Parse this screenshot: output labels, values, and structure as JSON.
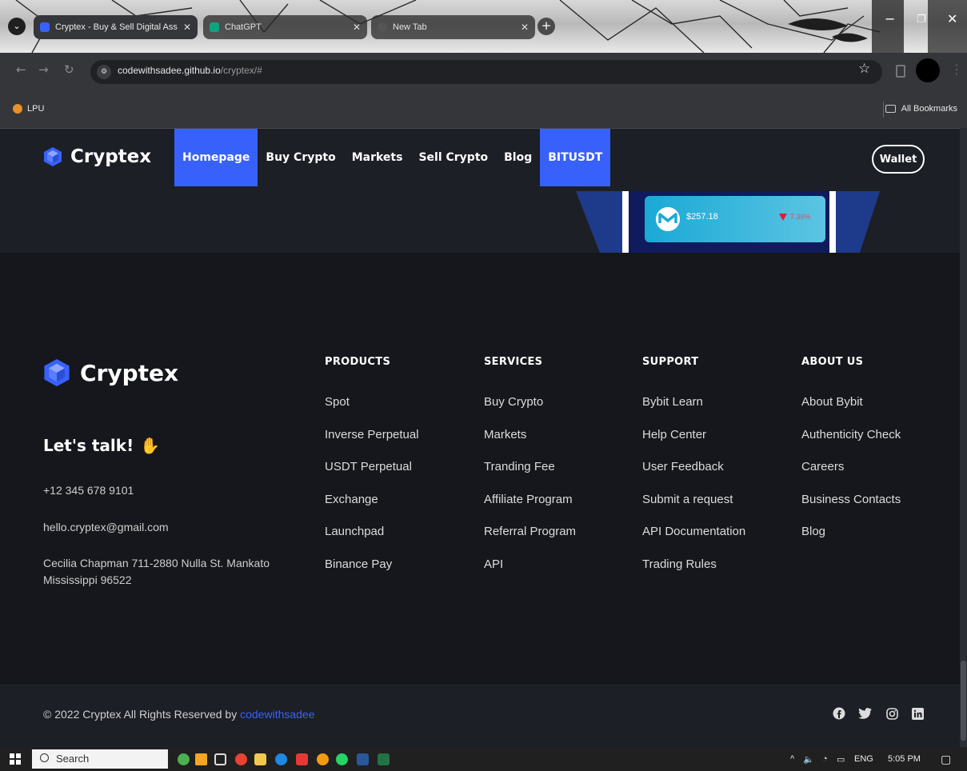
{
  "browser": {
    "tabs": [
      {
        "title": "Cryptex - Buy & Sell Digital Ass",
        "active": true
      },
      {
        "title": "ChatGPT",
        "active": false
      },
      {
        "title": "New Tab",
        "active": false
      }
    ],
    "url_host": "codewithsadee.github.io",
    "url_path": "/cryptex/#",
    "bookmarks": {
      "left": "LPU",
      "right": "All Bookmarks"
    }
  },
  "site": {
    "logo": "Cryptex",
    "nav": [
      "Homepage",
      "Buy Crypto",
      "Markets",
      "Sell Crypto",
      "Blog",
      "BITUSDT"
    ],
    "wallet": "Wallet",
    "ticker": {
      "price": "$257.18",
      "change": "7.39%"
    }
  },
  "footer": {
    "brand": "Cryptex",
    "talk": "Let's talk!",
    "phone": "+12 345 678 9101",
    "email": "hello.cryptex@gmail.com",
    "address_line1": "Cecilia Chapman 711-2880 Nulla St. Mankato",
    "address_line2": "Mississippi 96522",
    "columns": [
      {
        "title": "PRODUCTS",
        "links": [
          "Spot",
          "Inverse Perpetual",
          "USDT Perpetual",
          "Exchange",
          "Launchpad",
          "Binance Pay"
        ]
      },
      {
        "title": "SERVICES",
        "links": [
          "Buy Crypto",
          "Markets",
          "Tranding Fee",
          "Affiliate Program",
          "Referral Program",
          "API"
        ]
      },
      {
        "title": "SUPPORT",
        "links": [
          "Bybit Learn",
          "Help Center",
          "User Feedback",
          "Submit a request",
          "API Documentation",
          "Trading Rules"
        ]
      },
      {
        "title": "ABOUT US",
        "links": [
          "About Bybit",
          "Authenticity Check",
          "Careers",
          "Business Contacts",
          "Blog"
        ]
      }
    ],
    "copyright_prefix": "© 2022 Cryptex All Rights Reserved by",
    "copyright_author": "codewithsadee",
    "social_icons": [
      "facebook-icon",
      "twitter-icon",
      "instagram-icon",
      "linkedin-icon"
    ]
  },
  "taskbar": {
    "search": "Search",
    "tray_lang": "ENG",
    "time": "5:05 PM"
  },
  "colors": {
    "accent": "#3861fb",
    "bg": "#15171c",
    "panel": "#1c1f25"
  }
}
